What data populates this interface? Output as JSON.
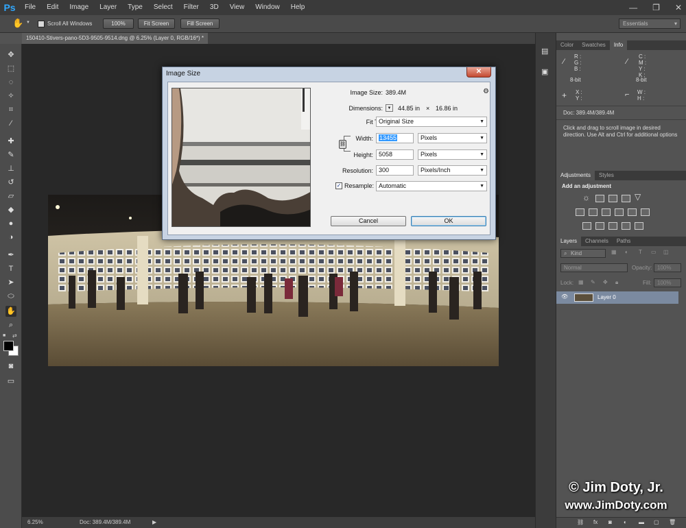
{
  "app": {
    "logo": "Ps"
  },
  "menu": [
    "File",
    "Edit",
    "Image",
    "Layer",
    "Type",
    "Select",
    "Filter",
    "3D",
    "View",
    "Window",
    "Help"
  ],
  "window_controls": {
    "minimize": "—",
    "maximize": "❐",
    "close": "✕"
  },
  "options_bar": {
    "scroll_all_windows": "Scroll All Windows",
    "zoom_100": "100%",
    "fit_screen": "Fit Screen",
    "fill_screen": "Fill Screen",
    "workspace": "Essentials"
  },
  "document_tab": {
    "label": "150410-Stivers-pano-5D3-9505-9514.dng @ 6.25% (Layer 0, RGB/16*) *",
    "close": "✕"
  },
  "status_bar": {
    "zoom": "6.25%",
    "doc": "Doc: 389.4M/389.4M"
  },
  "info_panel": {
    "tabs": [
      "Color",
      "Swatches",
      "Info"
    ],
    "rgb_labels": [
      "R :",
      "G :",
      "B :"
    ],
    "cmyk_labels": [
      "C :",
      "M :",
      "Y :",
      "K :"
    ],
    "bit_depth_left": "8-bit",
    "bit_depth_right": "8-bit",
    "xy_labels": [
      "X :",
      "Y :"
    ],
    "wh_labels": [
      "W :",
      "H :"
    ],
    "doc": "Doc: 389.4M/389.4M",
    "hint": "Click and drag to scroll image in desired direction.  Use Alt and Ctrl for additional options"
  },
  "adjustments_panel": {
    "tabs": [
      "Adjustments",
      "Styles"
    ],
    "heading": "Add an adjustment"
  },
  "layers_panel": {
    "tabs": [
      "Layers",
      "Channels",
      "Paths"
    ],
    "filter_kind": "Kind",
    "blend_mode": "Normal",
    "opacity_label": "Opacity:",
    "opacity_value": "100%",
    "lock_label": "Lock:",
    "fill_label": "Fill:",
    "fill_value": "100%",
    "layer_name": "Layer 0"
  },
  "dialog": {
    "title": "Image Size",
    "close": "✕",
    "image_size_label": "Image Size:",
    "image_size_value": "389.4M",
    "dimensions_label": "Dimensions:",
    "dimensions_width": "44.85 in",
    "dimensions_x": "×",
    "dimensions_height": "16.86 in",
    "fit_to_label": "Fit To:",
    "fit_to_value": "Original Size",
    "width_label": "Width:",
    "width_value": "13455",
    "width_unit": "Pixels",
    "height_label": "Height:",
    "height_value": "5058",
    "height_unit": "Pixels",
    "resolution_label": "Resolution:",
    "resolution_value": "300",
    "resolution_unit": "Pixels/Inch",
    "resample_label": "Resample:",
    "resample_value": "Automatic",
    "cancel": "Cancel",
    "ok": "OK"
  },
  "watermark": {
    "line1": "© Jim Doty, Jr.",
    "line2": "www.JimDoty.com"
  },
  "colors": {
    "ps_blue": "#31a8ff",
    "selected_layer": "#7b8aa0",
    "ok_border": "#3c7fb1"
  }
}
